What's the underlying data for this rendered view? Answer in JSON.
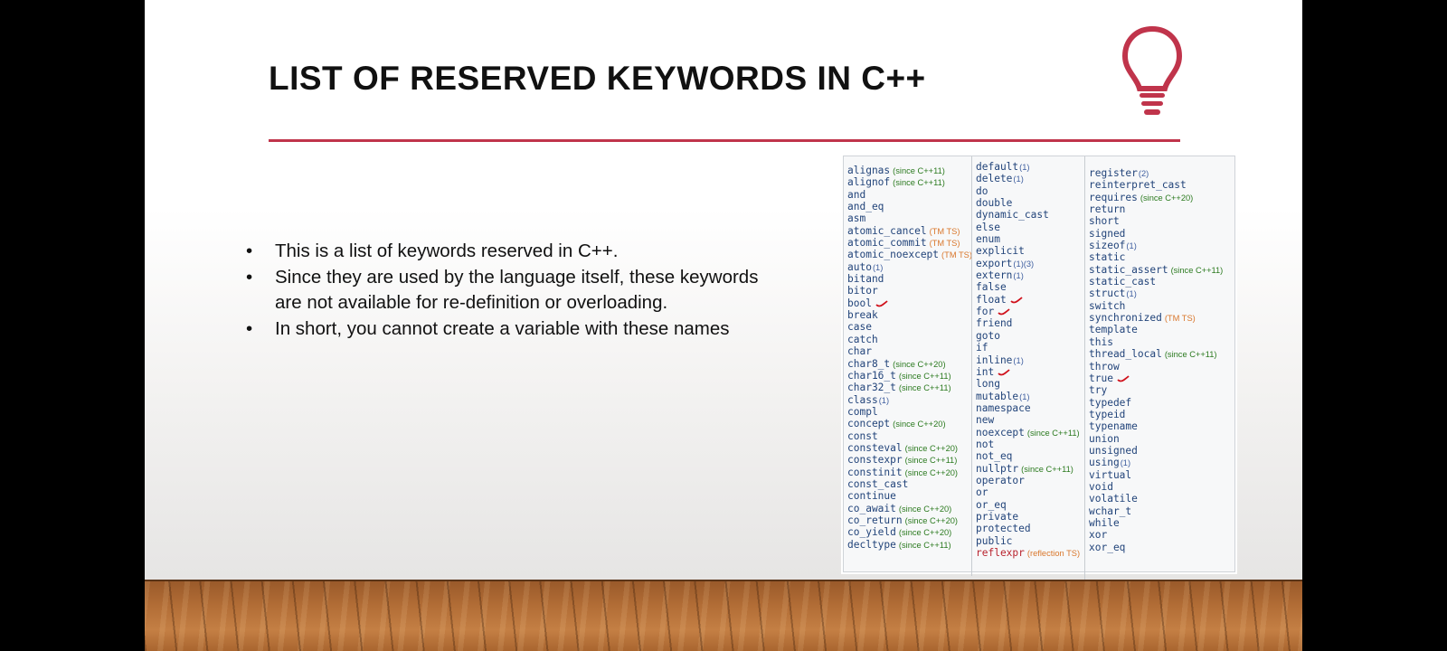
{
  "slide": {
    "title": "LIST OF RESERVED KEYWORDS IN C++",
    "accent_color": "#c0344b",
    "icon": "lightbulb-icon",
    "bullets": [
      "This is a list of keywords reserved in C++.",
      "Since they are used by the language itself, these keywords are not available for re-definition or overloading.",
      "In short, you cannot create a variable with these names"
    ]
  },
  "keyword_table": {
    "columns": [
      [
        {
          "kw": "alignas",
          "note": "(since C++11)",
          "nc": "green"
        },
        {
          "kw": "alignof",
          "note": "(since C++11)",
          "nc": "green"
        },
        {
          "kw": "and"
        },
        {
          "kw": "and_eq"
        },
        {
          "kw": "asm"
        },
        {
          "kw": "atomic_cancel",
          "note": "(TM TS)",
          "nc": "orange"
        },
        {
          "kw": "atomic_commit",
          "note": "(TM TS)",
          "nc": "orange"
        },
        {
          "kw": "atomic_noexcept",
          "note": "(TM TS)",
          "nc": "orange"
        },
        {
          "kw": "auto",
          "note": "(1)",
          "nc": "blue"
        },
        {
          "kw": "bitand"
        },
        {
          "kw": "bitor"
        },
        {
          "kw": "bool",
          "mark": true
        },
        {
          "kw": "break"
        },
        {
          "kw": "case"
        },
        {
          "kw": "catch"
        },
        {
          "kw": "char"
        },
        {
          "kw": "char8_t",
          "note": "(since C++20)",
          "nc": "green"
        },
        {
          "kw": "char16_t",
          "note": "(since C++11)",
          "nc": "green"
        },
        {
          "kw": "char32_t",
          "note": "(since C++11)",
          "nc": "green"
        },
        {
          "kw": "class",
          "note": "(1)",
          "nc": "blue"
        },
        {
          "kw": "compl"
        },
        {
          "kw": "concept",
          "note": "(since C++20)",
          "nc": "green"
        },
        {
          "kw": "const"
        },
        {
          "kw": "consteval",
          "note": "(since C++20)",
          "nc": "green"
        },
        {
          "kw": "constexpr",
          "note": "(since C++11)",
          "nc": "green"
        },
        {
          "kw": "constinit",
          "note": "(since C++20)",
          "nc": "green"
        },
        {
          "kw": "const_cast"
        },
        {
          "kw": "continue"
        },
        {
          "kw": "co_await",
          "note": "(since C++20)",
          "nc": "green"
        },
        {
          "kw": "co_return",
          "note": "(since C++20)",
          "nc": "green"
        },
        {
          "kw": "co_yield",
          "note": "(since C++20)",
          "nc": "green"
        },
        {
          "kw": "decltype",
          "note": "(since C++11)",
          "nc": "green"
        }
      ],
      [
        {
          "kw": "default",
          "note": "(1)",
          "nc": "blue"
        },
        {
          "kw": "delete",
          "note": "(1)",
          "nc": "blue"
        },
        {
          "kw": "do"
        },
        {
          "kw": "double"
        },
        {
          "kw": "dynamic_cast"
        },
        {
          "kw": "else"
        },
        {
          "kw": "enum"
        },
        {
          "kw": "explicit"
        },
        {
          "kw": "export",
          "note": "(1)(3)",
          "nc": "blue"
        },
        {
          "kw": "extern",
          "note": "(1)",
          "nc": "blue"
        },
        {
          "kw": "false"
        },
        {
          "kw": "float",
          "mark": true
        },
        {
          "kw": "for",
          "mark": true
        },
        {
          "kw": "friend"
        },
        {
          "kw": "goto"
        },
        {
          "kw": "if"
        },
        {
          "kw": "inline",
          "note": "(1)",
          "nc": "blue"
        },
        {
          "kw": "int",
          "mark": true
        },
        {
          "kw": "long"
        },
        {
          "kw": "mutable",
          "note": "(1)",
          "nc": "blue"
        },
        {
          "kw": "namespace"
        },
        {
          "kw": "new"
        },
        {
          "kw": "noexcept",
          "note": "(since C++11)",
          "nc": "green"
        },
        {
          "kw": "not"
        },
        {
          "kw": "not_eq"
        },
        {
          "kw": "nullptr",
          "note": "(since C++11)",
          "nc": "green"
        },
        {
          "kw": "operator"
        },
        {
          "kw": "or"
        },
        {
          "kw": "or_eq"
        },
        {
          "kw": "private"
        },
        {
          "kw": "protected"
        },
        {
          "kw": "public"
        },
        {
          "kw": "reflexpr",
          "note": "(reflection TS)",
          "nc": "orange",
          "red": true
        }
      ],
      [
        {
          "kw": "register",
          "note": "(2)",
          "nc": "blue"
        },
        {
          "kw": "reinterpret_cast"
        },
        {
          "kw": "requires",
          "note": "(since C++20)",
          "nc": "green"
        },
        {
          "kw": "return"
        },
        {
          "kw": "short"
        },
        {
          "kw": "signed"
        },
        {
          "kw": "sizeof",
          "note": "(1)",
          "nc": "blue"
        },
        {
          "kw": "static"
        },
        {
          "kw": "static_assert",
          "note": "(since C++11)",
          "nc": "green"
        },
        {
          "kw": "static_cast"
        },
        {
          "kw": "struct",
          "note": "(1)",
          "nc": "blue"
        },
        {
          "kw": "switch"
        },
        {
          "kw": "synchronized",
          "note": "(TM TS)",
          "nc": "orange"
        },
        {
          "kw": "template"
        },
        {
          "kw": "this"
        },
        {
          "kw": "thread_local",
          "note": "(since C++11)",
          "nc": "green"
        },
        {
          "kw": "throw"
        },
        {
          "kw": "true",
          "mark": true
        },
        {
          "kw": "try"
        },
        {
          "kw": "typedef"
        },
        {
          "kw": "typeid"
        },
        {
          "kw": "typename"
        },
        {
          "kw": "union"
        },
        {
          "kw": "unsigned"
        },
        {
          "kw": "using",
          "note": "(1)",
          "nc": "blue"
        },
        {
          "kw": "virtual"
        },
        {
          "kw": "void"
        },
        {
          "kw": "volatile"
        },
        {
          "kw": "wchar_t"
        },
        {
          "kw": "while"
        },
        {
          "kw": "xor"
        },
        {
          "kw": "xor_eq"
        }
      ]
    ]
  }
}
